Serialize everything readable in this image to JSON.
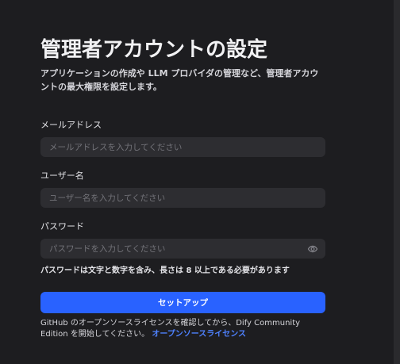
{
  "page": {
    "title": "管理者アカウントの設定",
    "subtitle": "アプリケーションの作成や LLM プロバイダの管理など、管理者アカウントの最大権限を設定します。"
  },
  "fields": {
    "email": {
      "label": "メールアドレス",
      "placeholder": "メールアドレスを入力してください",
      "value": ""
    },
    "username": {
      "label": "ユーザー名",
      "placeholder": "ユーザー名を入力してください",
      "value": ""
    },
    "password": {
      "label": "パスワード",
      "placeholder": "パスワードを入力してください",
      "value": "",
      "hint": "パスワードは文字と数字を含み、長さは 8 以上である必要があります",
      "toggle_icon": "eye-icon"
    }
  },
  "actions": {
    "setup_label": "セットアップ"
  },
  "footer": {
    "text": "GitHub のオープンソースライセンスを確認してから、Dify Community Edition を開始してください。 ",
    "link_label": "オープンソースライセンス"
  },
  "colors": {
    "background": "#1d1d20",
    "input_background": "#2d2d31",
    "primary_button": "#2962ff",
    "link": "#4f82ff",
    "text": "#f2f2f4"
  }
}
